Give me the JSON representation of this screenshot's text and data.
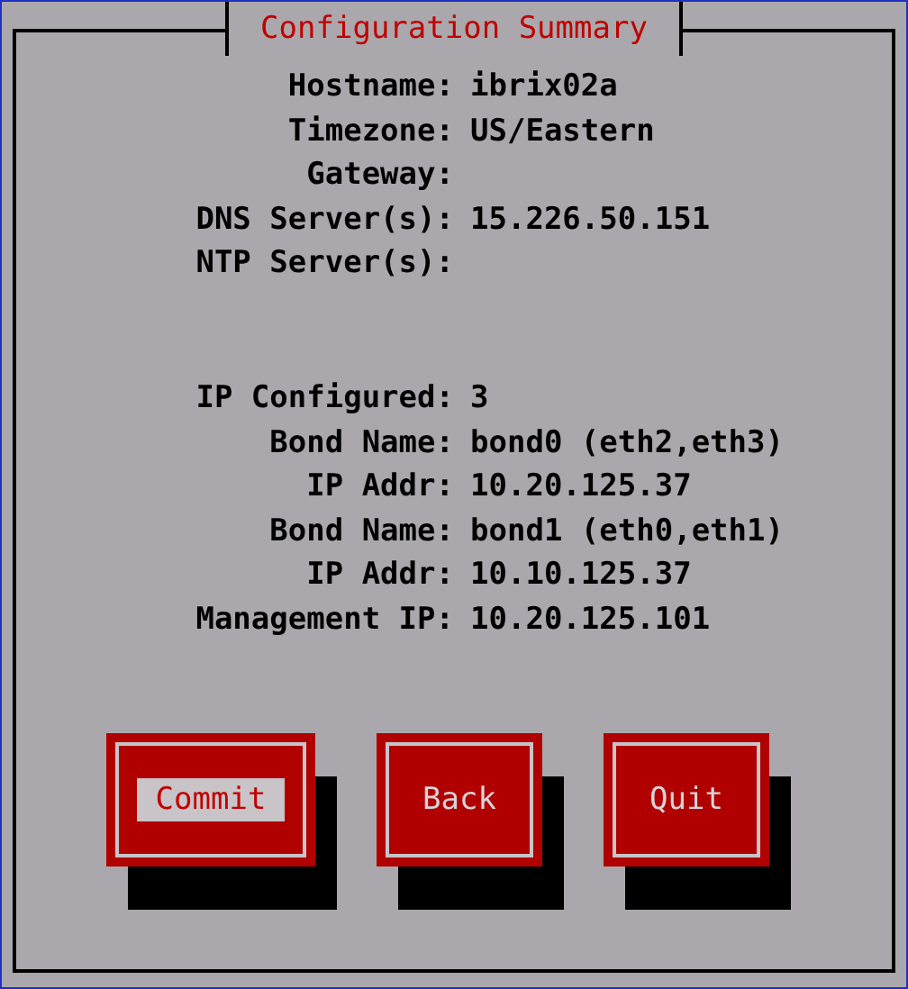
{
  "dialog": {
    "title": "Configuration Summary"
  },
  "general": [
    {
      "label": "Hostname:",
      "value": "ibrix02a"
    },
    {
      "label": "Timezone:",
      "value": "US/Eastern"
    },
    {
      "label": "Gateway:"
    },
    {
      "label": "DNS Server(s):",
      "value": "15.226.50.151"
    },
    {
      "label": "NTP Server(s):"
    }
  ],
  "network": [
    {
      "label": "IP Configured:",
      "value": "3"
    },
    {
      "label": "Bond Name:",
      "value": "bond0 (eth2,eth3)"
    },
    {
      "label": "IP Addr:",
      "value": "10.20.125.37"
    },
    {
      "label": "Bond Name:",
      "value": "bond1 (eth0,eth1)"
    },
    {
      "label": "IP Addr:",
      "value": "10.10.125.37"
    },
    {
      "label": "Management IP:",
      "value": "10.20.125.101"
    }
  ],
  "buttons": [
    {
      "label": "Commit",
      "selected": true
    },
    {
      "label": "Back",
      "selected": false
    },
    {
      "label": "Quit",
      "selected": false
    }
  ]
}
